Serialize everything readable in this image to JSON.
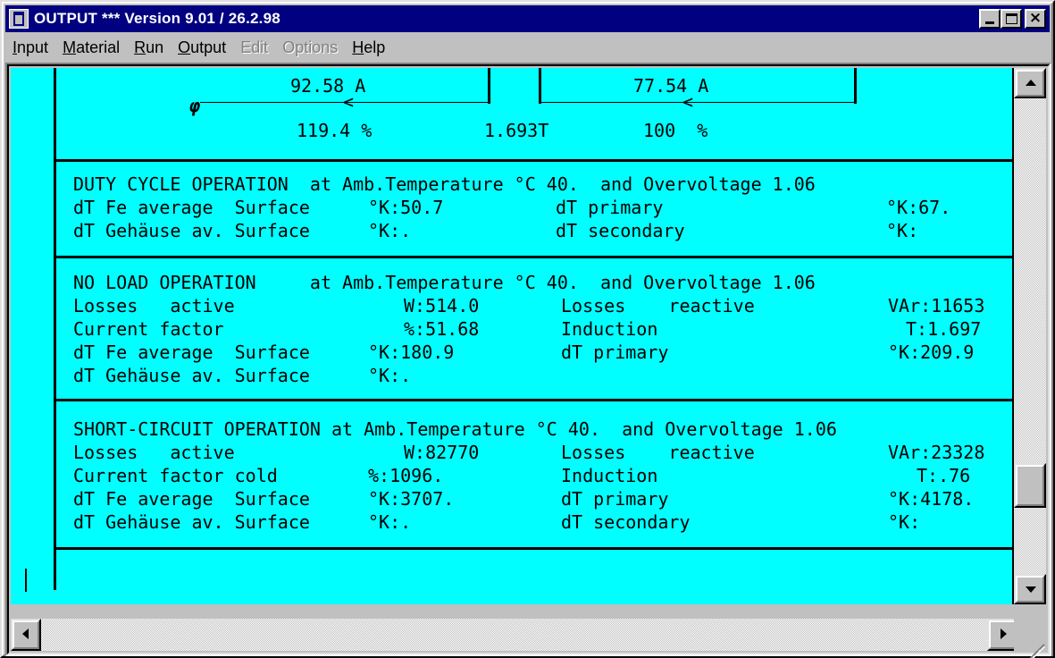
{
  "window": {
    "title": "OUTPUT *** Version 9.01 / 26.2.98"
  },
  "menu": [
    {
      "pre": "",
      "u": "I",
      "post": "nput",
      "disabled": false
    },
    {
      "pre": "",
      "u": "M",
      "post": "aterial",
      "disabled": false
    },
    {
      "pre": "",
      "u": "R",
      "post": "un",
      "disabled": false
    },
    {
      "pre": "",
      "u": "O",
      "post": "utput",
      "disabled": false
    },
    {
      "pre": "",
      "u": "E",
      "post": "dit",
      "disabled": true
    },
    {
      "pre": "",
      "u": "O",
      "post": "ptions",
      "disabled": true
    },
    {
      "pre": "",
      "u": "H",
      "post": "elp",
      "disabled": false
    }
  ],
  "diagram": {
    "primary_current": "92.58 A",
    "secondary_current": "77.54 A",
    "phase_symbol": "φ",
    "primary_percent": "119.4 %",
    "induction": "1.693T",
    "secondary_percent": "100  %"
  },
  "duty": {
    "title": "DUTY CYCLE OPERATION  at Amb.Temperature °C 40.  and Overvoltage 1.06",
    "row1": {
      "label": "dT Fe average  Surface",
      "value": "°K:50.7",
      "label2": "dT primary",
      "value2": "°K:67."
    },
    "row2": {
      "label": "dT Gehäuse av. Surface",
      "value": "°K:.",
      "label2": "dT secondary",
      "value2": "°K:"
    }
  },
  "noload": {
    "title": "NO LOAD OPERATION     at Amb.Temperature °C 40.  and Overvoltage 1.06",
    "row1": {
      "label": "Losses   active",
      "value": "W:514.0",
      "label2": "Losses    reactive",
      "value2": "VAr:11653"
    },
    "row2": {
      "label": "Current factor",
      "value": "%:51.68",
      "label2": "Induction",
      "value2": "T:1.697"
    },
    "row3": {
      "label": "dT Fe average  Surface",
      "value": "°K:180.9",
      "label2": "dT primary",
      "value2": "°K:209.9"
    },
    "row4": {
      "label": "dT Gehäuse av. Surface",
      "value": "°K:."
    }
  },
  "shortcircuit": {
    "title": "SHORT-CIRCUIT OPERATION at Amb.Temperature °C 40.  and Overvoltage 1.06",
    "row1": {
      "label": "Losses   active",
      "value": "W:82770",
      "label2": "Losses    reactive",
      "value2": "VAr:23328"
    },
    "row2": {
      "label": "Current factor cold",
      "value": "%:1096.",
      "label2": "Induction",
      "value2": "T:.76"
    },
    "row3": {
      "label": "dT Fe average  Surface",
      "value": "°K:3707.",
      "label2": "dT primary",
      "value2": "°K:4178."
    },
    "row4": {
      "label": "dT Gehäuse av. Surface",
      "value": "°K:.",
      "label2": "dT secondary",
      "value2": "°K:"
    }
  },
  "colors": {
    "background": "#00ffff",
    "titlebar": "#000080"
  }
}
